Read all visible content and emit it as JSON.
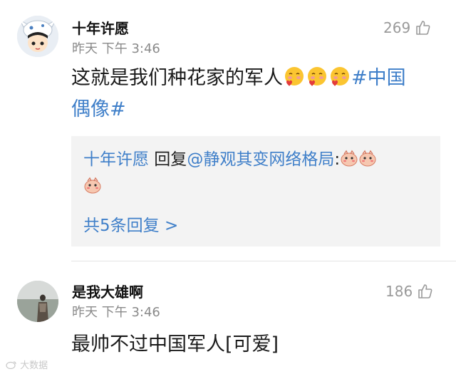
{
  "comments": [
    {
      "username": "十年许愿",
      "time": "昨天 下午 3:46",
      "likes": "269",
      "text_line1": "这就是我们种花家的军人",
      "hashtag_part1": "#中国",
      "hashtag_part2": "偶像#",
      "emoji": "blush-heart-emoji",
      "reply": {
        "author": "十年许愿",
        "action": " 回复",
        "mention": "@静观其变网络格局",
        "colon": ":",
        "more": "共5条回复 >"
      }
    },
    {
      "username": "是我大雄啊",
      "time": "昨天 下午 3:46",
      "likes": "186",
      "text": "最帅不过中国军人[可爱]"
    }
  ],
  "watermark": "大数据",
  "colors": {
    "link": "#3f7fc9",
    "reply_bg": "#f3f3f3",
    "muted": "#8a8a8a"
  }
}
